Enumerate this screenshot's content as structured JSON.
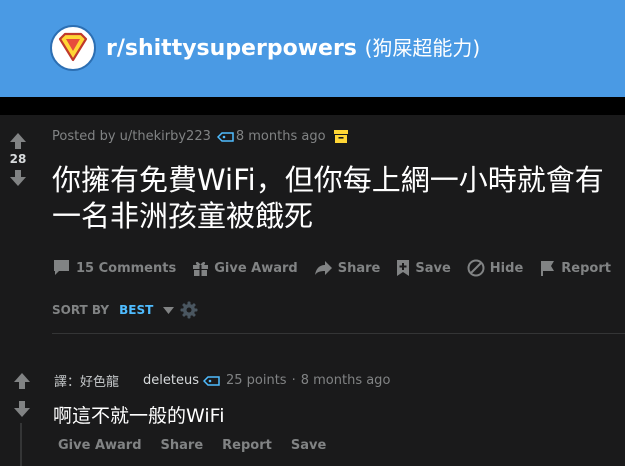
{
  "header": {
    "subreddit": "r/shittysuperpowers",
    "subreddit_cn": "(狗屎超能力)"
  },
  "post": {
    "score": "28",
    "posted_by": "Posted by u/thekirby223",
    "time": "8 months ago",
    "title": "你擁有免費WiFi，但你每上網一小時就會有一名非洲孩童被餓死",
    "actions": {
      "comments": "15 Comments",
      "give_award": "Give Award",
      "share": "Share",
      "save": "Save",
      "hide": "Hide",
      "report": "Report"
    }
  },
  "sort": {
    "label": "SORT BY",
    "value": "BEST"
  },
  "comment": {
    "flair": "譯：好色龍",
    "author": "deleteus",
    "points": "25 points",
    "separator": "·",
    "time": "8 months ago",
    "body": "啊這不就一般的WiFi",
    "actions": {
      "give_award": "Give Award",
      "share": "Share",
      "report": "Report",
      "save": "Save"
    }
  },
  "colors": {
    "header_bg": "#4a9ae4",
    "post_bg": "#1a1a1b",
    "accent_blue": "#4fbcff",
    "archive_yellow": "#ffd635",
    "muted": "#818384"
  }
}
